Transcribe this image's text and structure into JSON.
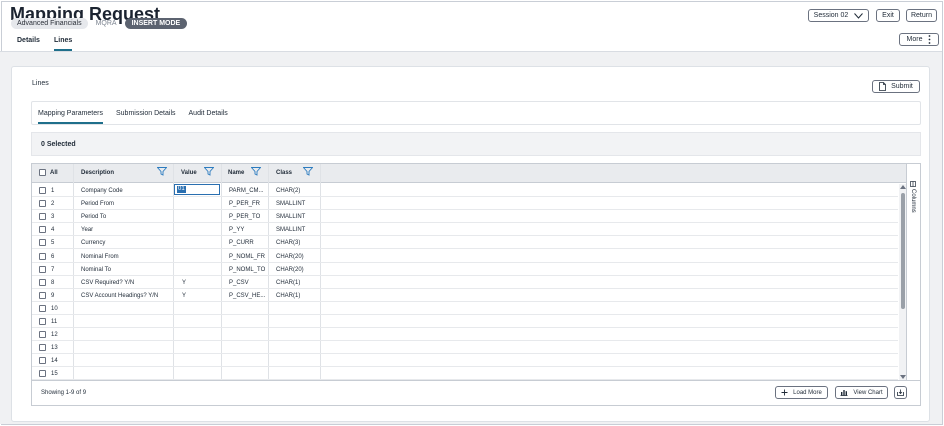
{
  "header": {
    "title": "Mapping Request",
    "chip_app": "Advanced Financials",
    "chip_code": "MQRA",
    "chip_mode": "INSERT MODE",
    "session_label": "Session 02",
    "exit_label": "Exit",
    "return_label": "Return",
    "more_label": "More"
  },
  "tabs": [
    {
      "label": "Details",
      "active": false
    },
    {
      "label": "Lines",
      "active": true
    }
  ],
  "section": {
    "title": "Lines",
    "submit_label": "Submit"
  },
  "subtabs": [
    {
      "label": "Mapping Parameters",
      "active": true
    },
    {
      "label": "Submission Details",
      "active": false
    },
    {
      "label": "Audit Details",
      "active": false
    }
  ],
  "selection": {
    "text": "0 Selected"
  },
  "grid": {
    "columns": {
      "all": "All",
      "description": "Description",
      "value": "Value",
      "name": "Name",
      "class": "Class"
    },
    "rows": [
      {
        "num": "1",
        "description": "Company Code",
        "value": "01",
        "name": "PARM_CM...",
        "class": "CHAR(2)"
      },
      {
        "num": "2",
        "description": "Period From",
        "value": "",
        "name": "P_PER_FR",
        "class": "SMALLINT"
      },
      {
        "num": "3",
        "description": "Period To",
        "value": "",
        "name": "P_PER_TO",
        "class": "SMALLINT"
      },
      {
        "num": "4",
        "description": "Year",
        "value": "",
        "name": "P_YY",
        "class": "SMALLINT"
      },
      {
        "num": "5",
        "description": "Currency",
        "value": "",
        "name": "P_CURR",
        "class": "CHAR(3)"
      },
      {
        "num": "6",
        "description": "Nominal From",
        "value": "",
        "name": "P_NOML_FR",
        "class": "CHAR(20)"
      },
      {
        "num": "7",
        "description": "Nominal To",
        "value": "",
        "name": "P_NOML_TO",
        "class": "CHAR(20)"
      },
      {
        "num": "8",
        "description": "CSV Required? Y/N",
        "value": "Y",
        "name": "P_CSV",
        "class": "CHAR(1)"
      },
      {
        "num": "9",
        "description": "CSV Account Headings? Y/N",
        "value": "Y",
        "name": "P_CSV_HE...",
        "class": "CHAR(1)"
      },
      {
        "num": "10",
        "description": "",
        "value": "",
        "name": "",
        "class": ""
      },
      {
        "num": "11",
        "description": "",
        "value": "",
        "name": "",
        "class": ""
      },
      {
        "num": "12",
        "description": "",
        "value": "",
        "name": "",
        "class": ""
      },
      {
        "num": "13",
        "description": "",
        "value": "",
        "name": "",
        "class": ""
      },
      {
        "num": "14",
        "description": "",
        "value": "",
        "name": "",
        "class": ""
      },
      {
        "num": "15",
        "description": "",
        "value": "",
        "name": "",
        "class": ""
      }
    ],
    "columns_panel_label": "Columns",
    "footer": {
      "showing": "Showing 1-9 of 9",
      "load_more": "Load More",
      "view_chart": "View Chart"
    }
  },
  "colors": {
    "accent": "#1f6f8b",
    "filter_icon": "#2b7bbf",
    "mode_chip": "#5c6370"
  },
  "icons": [
    "chevron-down-icon",
    "kebab-menu-icon",
    "document-icon",
    "filter-icon",
    "columns-icon",
    "plus-icon",
    "bar-chart-icon",
    "export-icon"
  ]
}
